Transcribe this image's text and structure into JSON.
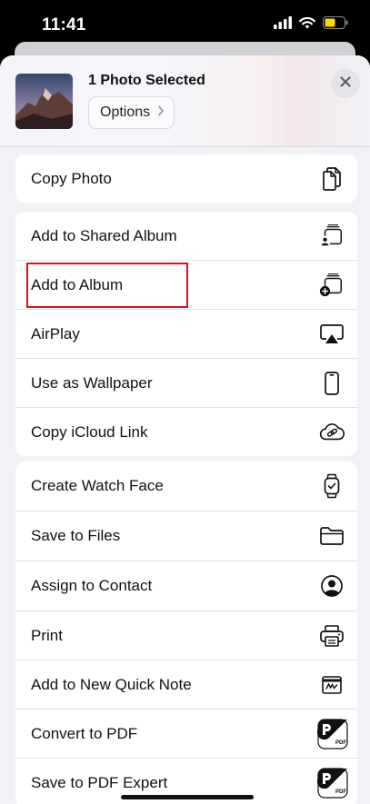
{
  "status": {
    "time": "11:41"
  },
  "header": {
    "title": "1 Photo Selected",
    "options_label": "Options"
  },
  "groups": [
    [
      {
        "label": "Copy Photo",
        "icon": "copy-photo-icon"
      }
    ],
    [
      {
        "label": "Add to Shared Album",
        "icon": "shared-album-icon"
      },
      {
        "label": "Add to Album",
        "icon": "add-album-icon"
      },
      {
        "label": "AirPlay",
        "icon": "airplay-icon"
      },
      {
        "label": "Use as Wallpaper",
        "icon": "phone-icon"
      },
      {
        "label": "Copy iCloud Link",
        "icon": "cloud-link-icon"
      }
    ],
    [
      {
        "label": "Create Watch Face",
        "icon": "watch-icon"
      },
      {
        "label": "Save to Files",
        "icon": "folder-icon"
      },
      {
        "label": "Assign to Contact",
        "icon": "contact-icon"
      },
      {
        "label": "Print",
        "icon": "printer-icon"
      },
      {
        "label": "Add to New Quick Note",
        "icon": "quick-note-icon"
      },
      {
        "label": "Convert to PDF",
        "icon": "pdf-convert-icon"
      },
      {
        "label": "Save to PDF Expert",
        "icon": "pdf-expert-icon"
      }
    ]
  ],
  "colors": {
    "highlight": "#d9121a",
    "battery": "#ffd60a"
  }
}
